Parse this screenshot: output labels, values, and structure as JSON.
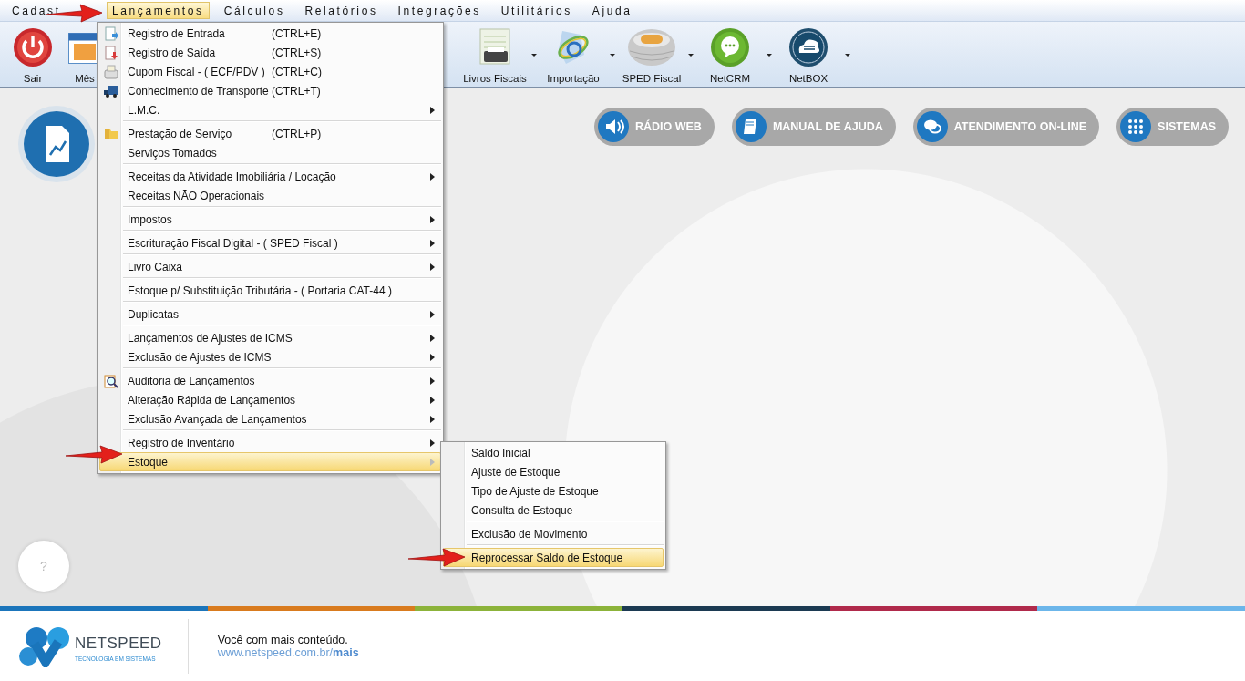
{
  "menu_bar": [
    {
      "label": "Cadast",
      "selected": false
    },
    {
      "label": "Lançamentos",
      "selected": true
    },
    {
      "label": "Cálculos",
      "selected": false
    },
    {
      "label": "Relatórios",
      "selected": false
    },
    {
      "label": "Integrações",
      "selected": false
    },
    {
      "label": "Utilitários",
      "selected": false
    },
    {
      "label": "Ajuda",
      "selected": false
    }
  ],
  "toolbar": [
    {
      "label": "Sair",
      "kind": "power",
      "dropdown": false
    },
    {
      "label": "Mês",
      "kind": "calendar",
      "dropdown": false
    },
    {
      "label": "Livros Fiscais",
      "kind": "printer",
      "dropdown": true
    },
    {
      "label": "Importação",
      "kind": "nfe",
      "dropdown": true
    },
    {
      "label": "SPED Fiscal",
      "kind": "globe",
      "dropdown": true
    },
    {
      "label": "NetCRM",
      "kind": "chat",
      "dropdown": true
    },
    {
      "label": "NetBOX",
      "kind": "cloud",
      "dropdown": true
    }
  ],
  "dropdown_menu": {
    "groups": [
      {
        "items": [
          {
            "label": "Registro de Entrada",
            "shortcut": "(CTRL+E)",
            "kind": "entry",
            "has_submenu": false,
            "selected": false
          },
          {
            "label": "Registro de Saída",
            "shortcut": "(CTRL+S)",
            "kind": "exit",
            "has_submenu": false,
            "selected": false
          },
          {
            "label": "Cupom Fiscal - ( ECF/PDV )",
            "shortcut": "(CTRL+C)",
            "kind": "register",
            "has_submenu": false,
            "selected": false
          },
          {
            "label": "Conhecimento de Transporte (CTRL+T)",
            "kind": "truck",
            "has_submenu": false,
            "selected": false
          },
          {
            "label": "L.M.C.",
            "kind": "plain",
            "has_submenu": true,
            "selected": false
          }
        ]
      },
      {
        "items": [
          {
            "label": "Prestação de Serviço",
            "shortcut": "(CTRL+P)",
            "kind": "folder",
            "has_submenu": false,
            "selected": false
          },
          {
            "label": "Serviços Tomados",
            "kind": "plain",
            "has_submenu": false,
            "selected": false
          }
        ]
      },
      {
        "items": [
          {
            "label": "Receitas da Atividade Imobiliária / Locação",
            "kind": "plain",
            "has_submenu": true,
            "selected": false
          },
          {
            "label": "Receitas NÃO Operacionais",
            "kind": "plain",
            "has_submenu": false,
            "selected": false
          }
        ]
      },
      {
        "items": [
          {
            "label": "Impostos",
            "kind": "plain",
            "has_submenu": true,
            "selected": false
          }
        ]
      },
      {
        "items": [
          {
            "label": "Escrituração Fiscal Digital - ( SPED Fiscal )",
            "kind": "plain",
            "has_submenu": true,
            "selected": false
          }
        ]
      },
      {
        "items": [
          {
            "label": "Livro Caixa",
            "kind": "plain",
            "has_submenu": true,
            "selected": false
          }
        ]
      },
      {
        "items": [
          {
            "label": "Estoque p/ Substituição Tributária - ( Portaria CAT-44 )",
            "kind": "plain",
            "has_submenu": false,
            "selected": false
          }
        ]
      },
      {
        "items": [
          {
            "label": "Duplicatas",
            "kind": "plain",
            "has_submenu": true,
            "selected": false
          }
        ]
      },
      {
        "items": [
          {
            "label": "Lançamentos de Ajustes de ICMS",
            "kind": "plain",
            "has_submenu": true,
            "selected": false
          },
          {
            "label": "Exclusão de Ajustes de ICMS",
            "kind": "plain",
            "has_submenu": true,
            "selected": false
          }
        ]
      },
      {
        "items": [
          {
            "label": "Auditoria de Lançamentos",
            "kind": "audit",
            "has_submenu": true,
            "selected": false
          },
          {
            "label": "Alteração Rápida de Lançamentos",
            "kind": "plain",
            "has_submenu": true,
            "selected": false
          },
          {
            "label": "Exclusão Avançada de Lançamentos",
            "kind": "plain",
            "has_submenu": true,
            "selected": false
          }
        ]
      },
      {
        "items": [
          {
            "label": "Registro de Inventário",
            "kind": "plain",
            "has_submenu": true,
            "selected": false
          },
          {
            "label": "Estoque",
            "kind": "plain",
            "has_submenu": true,
            "selected": true
          }
        ]
      }
    ]
  },
  "submenu": {
    "groups": [
      {
        "items": [
          {
            "label": "Saldo Inicial",
            "has_submenu": false,
            "selected": false
          },
          {
            "label": "Ajuste de Estoque",
            "has_submenu": false,
            "selected": false
          },
          {
            "label": "Tipo de Ajuste de Estoque",
            "has_submenu": false,
            "selected": false
          },
          {
            "label": "Consulta de Estoque",
            "has_submenu": false,
            "selected": false
          }
        ]
      },
      {
        "items": [
          {
            "label": "Exclusão de Movimento",
            "has_submenu": false,
            "selected": false
          }
        ]
      },
      {
        "items": [
          {
            "label": "Reprocessar Saldo de Estoque",
            "has_submenu": false,
            "selected": true
          }
        ]
      }
    ]
  },
  "quick_links": [
    {
      "label": "RÁDIO WEB",
      "kind": "speaker"
    },
    {
      "label": "MANUAL DE AJUDA",
      "kind": "book"
    },
    {
      "label": "ATENDIMENTO ON-LINE",
      "kind": "chat"
    },
    {
      "label": "SISTEMAS",
      "kind": "grid"
    }
  ],
  "help_button": {
    "label": "?"
  },
  "footer": {
    "brand": "NETSPEED",
    "tagline": "TECNOLOGIA EM SISTEMAS",
    "message": "Você com mais conteúdo.",
    "link": "www.netspeed.com.br/**mais**"
  }
}
